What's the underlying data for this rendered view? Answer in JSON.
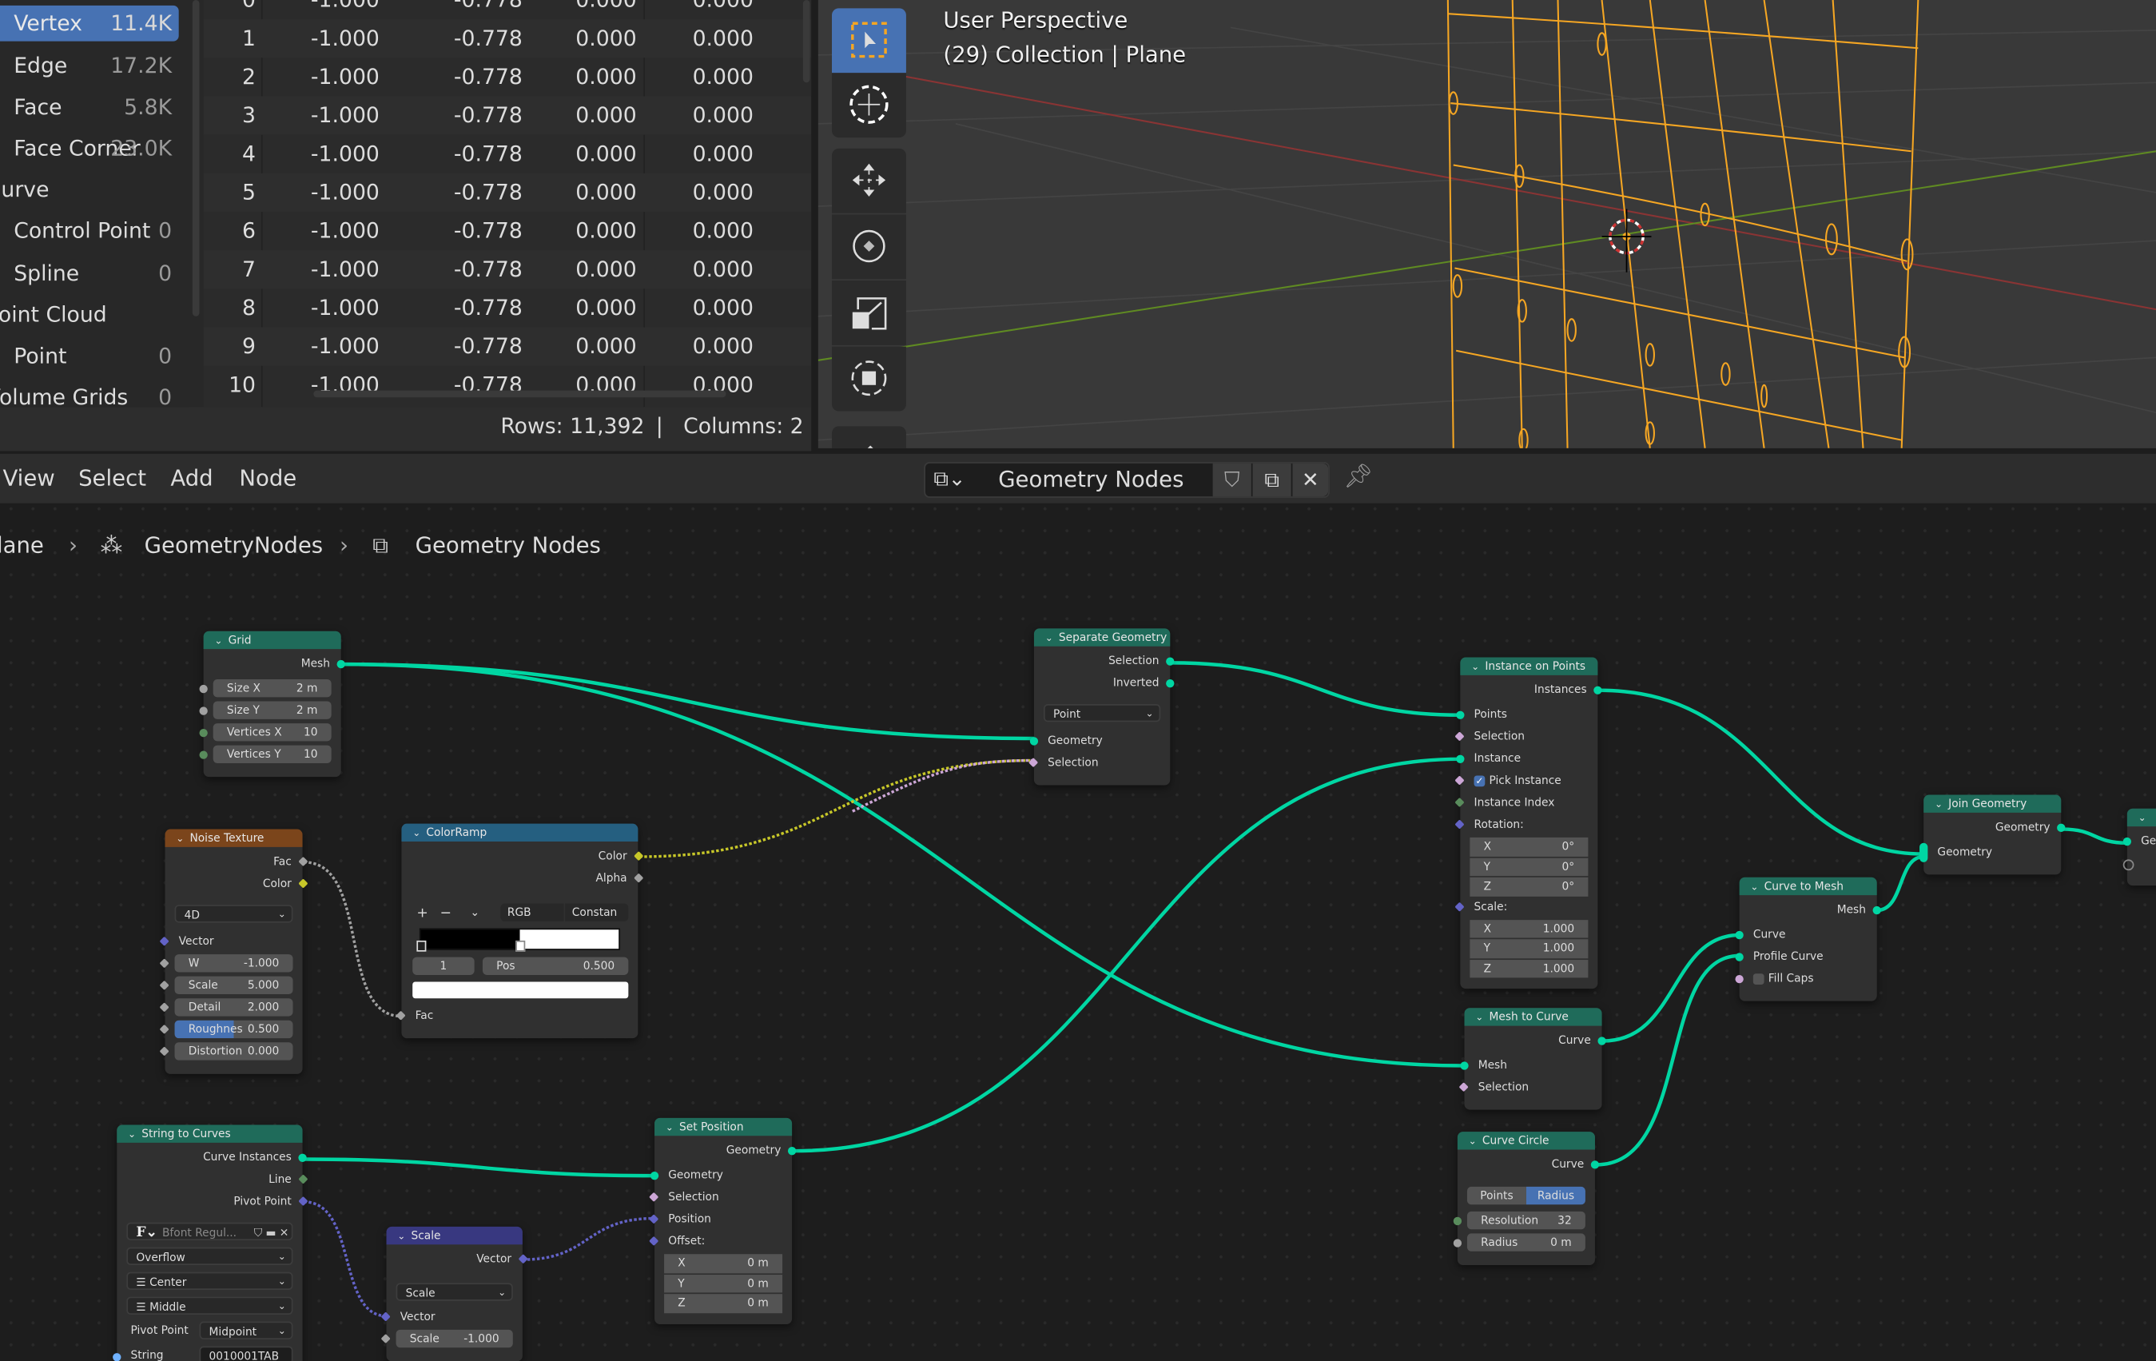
{
  "spreadsheet": {
    "domains": [
      {
        "label": "Vertex",
        "count": "11.4K",
        "selected": true
      },
      {
        "label": "Edge",
        "count": "17.2K"
      },
      {
        "label": "Face",
        "count": "5.8K"
      },
      {
        "label": "Face Corner",
        "count": "23.0K"
      },
      {
        "label": "Curve",
        "count": "",
        "category": true
      },
      {
        "label": "Control Point",
        "count": "0"
      },
      {
        "label": "Spline",
        "count": "0"
      },
      {
        "label": "Point Cloud",
        "count": "",
        "category": true
      },
      {
        "label": "Point",
        "count": "0"
      },
      {
        "label": "Volume Grids",
        "count": "0",
        "category": true
      }
    ],
    "rows": [
      [
        "0",
        "-1.000",
        "-0.778",
        "0.000",
        "0.000"
      ],
      [
        "1",
        "-1.000",
        "-0.778",
        "0.000",
        "0.000"
      ],
      [
        "2",
        "-1.000",
        "-0.778",
        "0.000",
        "0.000"
      ],
      [
        "3",
        "-1.000",
        "-0.778",
        "0.000",
        "0.000"
      ],
      [
        "4",
        "-1.000",
        "-0.778",
        "0.000",
        "0.000"
      ],
      [
        "5",
        "-1.000",
        "-0.778",
        "0.000",
        "0.000"
      ],
      [
        "6",
        "-1.000",
        "-0.778",
        "0.000",
        "0.000"
      ],
      [
        "7",
        "-1.000",
        "-0.778",
        "0.000",
        "0.000"
      ],
      [
        "8",
        "-1.000",
        "-0.778",
        "0.000",
        "0.000"
      ],
      [
        "9",
        "-1.000",
        "-0.778",
        "0.000",
        "0.000"
      ],
      [
        "10",
        "-1.000",
        "-0.778",
        "0.000",
        "0.000"
      ]
    ],
    "footer": {
      "rows": "Rows: 11,392",
      "sep": "|",
      "columns": "Columns: 2"
    }
  },
  "viewport": {
    "title": "User Perspective",
    "subtitle": "(29) Collection | Plane",
    "tools": [
      "select-box-icon",
      "cursor-icon",
      "move-icon",
      "rotate-icon",
      "scale-icon",
      "transform-icon",
      "annotate-icon"
    ],
    "active_tool": "select-box-icon"
  },
  "node_editor": {
    "menu": [
      "View",
      "Select",
      "Add",
      "Node"
    ],
    "tree_name": "Geometry Nodes",
    "breadcrumb": [
      "Plane",
      "GeometryNodes",
      "Geometry Nodes"
    ],
    "nodes": [
      {
        "title": "Grid",
        "color": "#1f6b5a",
        "rows": [
          {
            "k": "out",
            "t": "Mesh",
            "s": "geo"
          },
          {
            "k": "field",
            "t": "Size X",
            "v": "2 m",
            "s": "float"
          },
          {
            "k": "field",
            "t": "Size Y",
            "v": "2 m",
            "s": "float"
          },
          {
            "k": "field",
            "t": "Vertices X",
            "v": "10",
            "s": "int"
          },
          {
            "k": "field",
            "t": "Vertices Y",
            "v": "10",
            "s": "int"
          }
        ]
      },
      {
        "title": "Noise Texture",
        "color": "#7b451b",
        "rows": [
          {
            "k": "out",
            "t": "Fac",
            "s": "float",
            "d": true
          },
          {
            "k": "out",
            "t": "Color",
            "s": "col",
            "d": true
          },
          {
            "k": "sel",
            "v": "4D"
          },
          {
            "k": "in",
            "t": "Vector",
            "s": "vec",
            "d": true
          },
          {
            "k": "field",
            "t": "W",
            "v": "-1.000",
            "s": "float",
            "d": true
          },
          {
            "k": "field",
            "t": "Scale",
            "v": "5.000",
            "s": "float",
            "d": true
          },
          {
            "k": "field",
            "t": "Detail",
            "v": "2.000",
            "s": "float",
            "d": true
          },
          {
            "k": "field",
            "t": "Roughnes",
            "v": "0.500",
            "s": "float",
            "d": true,
            "fill": 0.5
          },
          {
            "k": "field",
            "t": "Distortion",
            "v": "0.000",
            "s": "float",
            "d": true
          }
        ]
      },
      {
        "title": "ColorRamp",
        "color": "#255f80",
        "rows": [
          {
            "k": "out",
            "t": "Color",
            "s": "col",
            "d": true
          },
          {
            "k": "out",
            "t": "Alpha",
            "s": "float",
            "d": true
          },
          {
            "k": "ramp",
            "add": "+",
            "remove": "−",
            "mode": "RGB",
            "interp": "Constan",
            "index": "1",
            "pos_label": "Pos",
            "pos": "0.500",
            "stop": 0.5
          },
          {
            "k": "in",
            "t": "Fac",
            "s": "float",
            "d": true
          }
        ]
      },
      {
        "title": "Separate Geometry",
        "color": "#1f6b5a",
        "rows": [
          {
            "k": "out",
            "t": "Selection",
            "s": "geo"
          },
          {
            "k": "out",
            "t": "Inverted",
            "s": "geo"
          },
          {
            "k": "sel",
            "v": "Point"
          },
          {
            "k": "in",
            "t": "Geometry",
            "s": "geo"
          },
          {
            "k": "in",
            "t": "Selection",
            "s": "bool",
            "d": true
          }
        ]
      },
      {
        "title": "Instance on Points",
        "color": "#1f6b5a",
        "rows": [
          {
            "k": "out",
            "t": "Instances",
            "s": "geo"
          },
          {
            "k": "in",
            "t": "Points",
            "s": "geo"
          },
          {
            "k": "in",
            "t": "Selection",
            "s": "bool",
            "d": true
          },
          {
            "k": "in",
            "t": "Instance",
            "s": "geo"
          },
          {
            "k": "check",
            "t": "Pick Instance",
            "checked": true,
            "s": "bool",
            "d": true
          },
          {
            "k": "in",
            "t": "Instance Index",
            "s": "int",
            "d": true
          },
          {
            "k": "in",
            "t": "Rotation:",
            "s": "vec",
            "d": true
          },
          {
            "k": "vf",
            "t": "X",
            "v": "0°"
          },
          {
            "k": "vf",
            "t": "Y",
            "v": "0°"
          },
          {
            "k": "vf",
            "t": "Z",
            "v": "0°"
          },
          {
            "k": "in",
            "t": "Scale:",
            "s": "vec",
            "d": true
          },
          {
            "k": "vf",
            "t": "X",
            "v": "1.000"
          },
          {
            "k": "vf",
            "t": "Y",
            "v": "1.000"
          },
          {
            "k": "vf",
            "t": "Z",
            "v": "1.000"
          }
        ]
      },
      {
        "title": "Join Geometry",
        "color": "#1f6b5a",
        "rows": [
          {
            "k": "out",
            "t": "Geometry",
            "s": "geo"
          },
          {
            "k": "in",
            "t": "Geometry",
            "s": "geo",
            "multi": true
          }
        ]
      },
      {
        "title": "Curve to Mesh",
        "color": "#1f6b5a",
        "rows": [
          {
            "k": "out",
            "t": "Mesh",
            "s": "geo"
          },
          {
            "k": "in",
            "t": "Curve",
            "s": "geo"
          },
          {
            "k": "in",
            "t": "Profile Curve",
            "s": "geo"
          },
          {
            "k": "check",
            "t": "Fill Caps",
            "checked": false,
            "s": "bool"
          }
        ]
      },
      {
        "title": "Mesh to Curve",
        "color": "#1f6b5a",
        "rows": [
          {
            "k": "out",
            "t": "Curve",
            "s": "geo"
          },
          {
            "k": "in",
            "t": "Mesh",
            "s": "geo"
          },
          {
            "k": "in",
            "t": "Selection",
            "s": "bool",
            "d": true
          }
        ]
      },
      {
        "title": "Curve Circle",
        "color": "#1f6b5a",
        "rows": [
          {
            "k": "out",
            "t": "Curve",
            "s": "geo"
          },
          {
            "k": "toggle",
            "opts": [
              "Points",
              "Radius"
            ],
            "active": 1
          },
          {
            "k": "field",
            "t": "Resolution",
            "v": "32",
            "s": "int"
          },
          {
            "k": "field",
            "t": "Radius",
            "v": "0 m",
            "s": "float"
          }
        ]
      },
      {
        "title": "String to Curves",
        "color": "#1f6b5a",
        "rows": [
          {
            "k": "out",
            "t": "Curve Instances",
            "s": "geo"
          },
          {
            "k": "out",
            "t": "Line",
            "s": "int",
            "d": true
          },
          {
            "k": "out",
            "t": "Pivot Point",
            "s": "vec",
            "d": true
          },
          {
            "k": "font",
            "v": "Bfont Regul..."
          },
          {
            "k": "sel",
            "v": "Overflow"
          },
          {
            "k": "sel",
            "v": "Center",
            "icon": "align-center-icon"
          },
          {
            "k": "sel",
            "v": "Middle",
            "icon": "align-middle-icon"
          },
          {
            "k": "lsel",
            "t": "Pivot Point",
            "v": "Midpoint"
          },
          {
            "k": "lfield",
            "t": "String",
            "v": "0010001TAB",
            "s": "str"
          }
        ]
      },
      {
        "title": "Scale",
        "color": "#383880",
        "rows": [
          {
            "k": "out",
            "t": "Vector",
            "s": "vec",
            "d": true
          },
          {
            "k": "sel",
            "v": "Scale"
          },
          {
            "k": "in",
            "t": "Vector",
            "s": "vec",
            "d": true
          },
          {
            "k": "field",
            "t": "Scale",
            "v": "-1.000",
            "s": "float",
            "d": true
          }
        ]
      },
      {
        "title": "Set Position",
        "color": "#1f6b5a",
        "rows": [
          {
            "k": "out",
            "t": "Geometry",
            "s": "geo"
          },
          {
            "k": "in",
            "t": "Geometry",
            "s": "geo"
          },
          {
            "k": "in",
            "t": "Selection",
            "s": "bool",
            "d": true
          },
          {
            "k": "in",
            "t": "Position",
            "s": "vec",
            "d": true
          },
          {
            "k": "in",
            "t": "Offset:",
            "s": "vec",
            "d": true
          },
          {
            "k": "vf",
            "t": "X",
            "v": "0 m"
          },
          {
            "k": "vf",
            "t": "Y",
            "v": "0 m"
          },
          {
            "k": "vf",
            "t": "Z",
            "v": "0 m"
          }
        ]
      },
      {
        "title": "",
        "color": "#1f6b5a",
        "rows": [
          {
            "k": "in",
            "t": "Geo",
            "s": "geo"
          },
          {
            "k": "in",
            "t": "",
            "s": "empty"
          }
        ]
      }
    ],
    "socket_colors": {
      "geo": "#00d6a3",
      "float": "#a1a1a1",
      "int": "#598c5c",
      "vec": "#6363c7",
      "col": "#c7c729",
      "bool": "#cca6d6",
      "str": "#70b2ff",
      "empty": "transparent"
    }
  },
  "colors": {
    "accent": "#4772b3",
    "wire_geometry": "#00d6a3",
    "wireframe": "#f5a623",
    "x_axis": "#9c3b3b",
    "y_axis": "#6b8e23"
  }
}
